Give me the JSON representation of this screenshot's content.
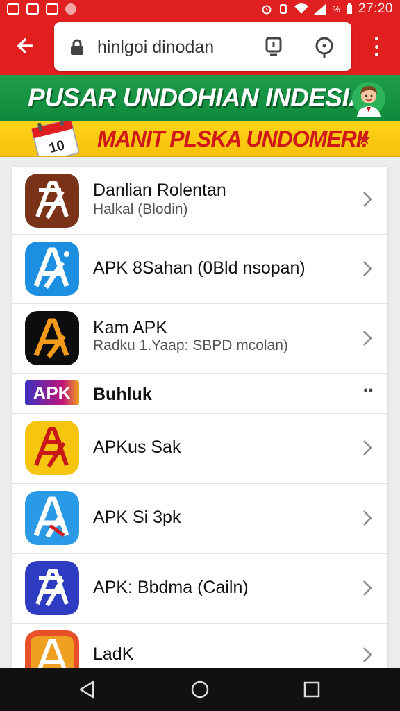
{
  "status_bar": {
    "battery_pct": "%",
    "time": "27:20"
  },
  "browser": {
    "url_text": "hinlgoi dinodan",
    "icons": [
      "arrow-back-icon",
      "lock-icon",
      "download-icon",
      "location-icon",
      "more-vert-icon"
    ]
  },
  "banner": {
    "title": "PUSAR UNDOHIAN INDESIA",
    "subtitle": "MANIT PLSKA UNDOMERI!",
    "calendar_text": "10"
  },
  "list": {
    "items": [
      {
        "title": "Danlian Rolentan",
        "subtitle": "Halkal (Blodin)",
        "icon_color": "#7a3318",
        "action": "chevron"
      },
      {
        "title": "APK 8Sahan (0Bld nsopan)",
        "subtitle": "",
        "icon_color": "#1d8fe0",
        "action": "chevron"
      },
      {
        "title": "Kam APK",
        "subtitle": "Radku 1.Yaap: SBPD mcolan)",
        "icon_color": "#0d0d0d",
        "action": "chevron"
      },
      {
        "title": "Buhluk",
        "subtitle": "",
        "badge": "APK",
        "action": "dots"
      },
      {
        "title": "APKus Sak",
        "subtitle": "",
        "icon_color": "#f6c510",
        "action": "chevron"
      },
      {
        "title": "APK Si 3pk",
        "subtitle": "",
        "icon_color": "#2a9ae6",
        "action": "chevron"
      },
      {
        "title": "APK: Bbdma (Cailn)",
        "subtitle": "",
        "icon_color": "#2d3cc0",
        "action": "chevron"
      },
      {
        "title": "LadK",
        "subtitle": "",
        "icon_color": "#e8502a",
        "action": "chevron"
      }
    ]
  },
  "colors": {
    "toolbar": "#e21f1f",
    "banner_green": "#1e9d4c",
    "banner_yellow": "#ffd319",
    "banner_red_text": "#d01818"
  }
}
